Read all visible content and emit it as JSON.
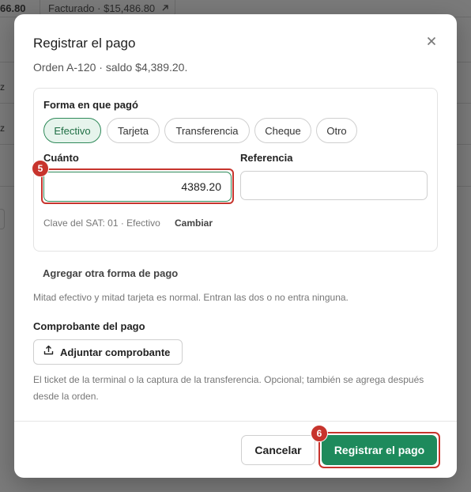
{
  "background": {
    "amount": "66.80",
    "pill_text": "Facturado · $15,486.80",
    "row_marks": [
      "z",
      "z"
    ]
  },
  "modal": {
    "title": "Registrar el pago",
    "subtitle": "Orden A-120 · saldo $4,389.20.",
    "method_label": "Forma en que pagó",
    "methods": [
      {
        "label": "Efectivo",
        "active": true
      },
      {
        "label": "Tarjeta",
        "active": false
      },
      {
        "label": "Transferencia",
        "active": false
      },
      {
        "label": "Cheque",
        "active": false
      },
      {
        "label": "Otro",
        "active": false
      }
    ],
    "amount_label": "Cuánto",
    "amount_value": "4389.20",
    "reference_label": "Referencia",
    "reference_value": "",
    "sat_text": "Clave del SAT: 01 · Efectivo",
    "sat_change": "Cambiar",
    "add_method": "Agregar otra forma de pago",
    "split_hint": "Mitad efectivo y mitad tarjeta es normal. Entran las dos o no entra ninguna.",
    "receipt_label": "Comprobante del pago",
    "attach_button": "Adjuntar comprobante",
    "attach_hint": "El ticket de la terminal o la captura de la transferencia. Opcional; también se agrega después desde la orden.",
    "cancel_button": "Cancelar",
    "submit_button": "Registrar el pago"
  },
  "annotations": {
    "step_amount": "5",
    "step_submit": "6"
  },
  "colors": {
    "accent": "#1e8a5c",
    "highlight": "#c7342d",
    "chip_active_bg": "#e6f4ec"
  }
}
